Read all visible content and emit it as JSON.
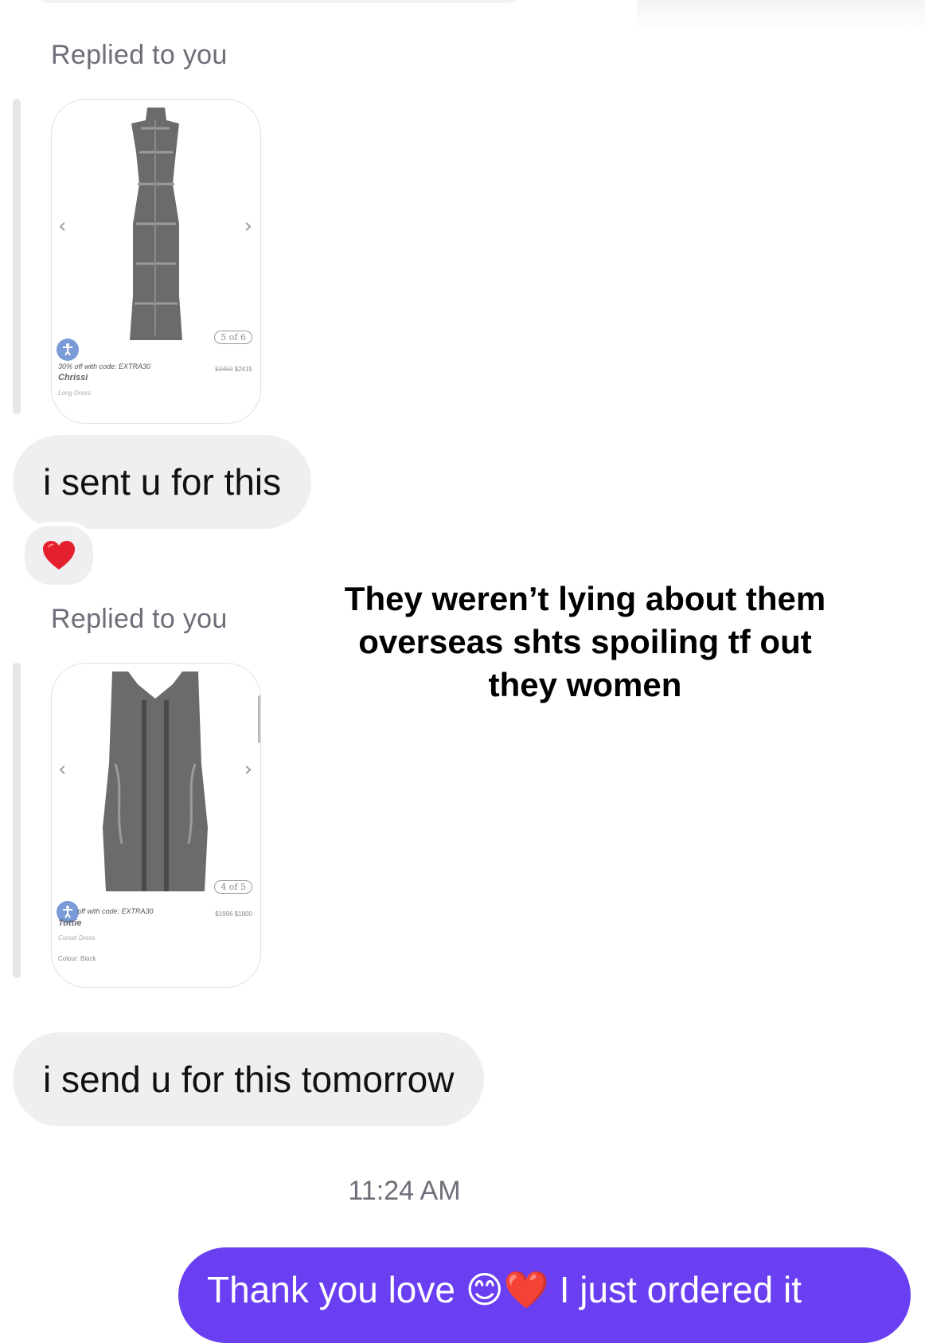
{
  "thread": {
    "replies": [
      {
        "label": "Replied to you",
        "card": {
          "counter": "5 of 6",
          "promo": "30% off with code: EXTRA30",
          "old_price": "$3450",
          "new_price": "$2415",
          "name": "Chrissi",
          "type": "Long Dress",
          "colour": ""
        },
        "message": "i sent u for this",
        "reaction": "heart"
      },
      {
        "label": "Replied to you",
        "card": {
          "counter": "4 of 5",
          "promo": "off with code: EXTRA30",
          "old_price": "$1996",
          "new_price": "$1800",
          "name": "Tottie",
          "type": "Corset Dress",
          "colour": "Colour: Black"
        },
        "message": "i send u for this tomorrow"
      }
    ],
    "timestamp": "11:24 AM",
    "sent_message": "Thank you love 😊❤️ I just ordered it"
  },
  "overlay_caption": "They weren’t lying about them overseas shts spoiling tf out they women",
  "colors": {
    "sent_bubble": "#6a3ff2",
    "received_bubble": "#efeff2",
    "label_gray": "#6e6e78",
    "reaction_heart": "#e5202e"
  }
}
